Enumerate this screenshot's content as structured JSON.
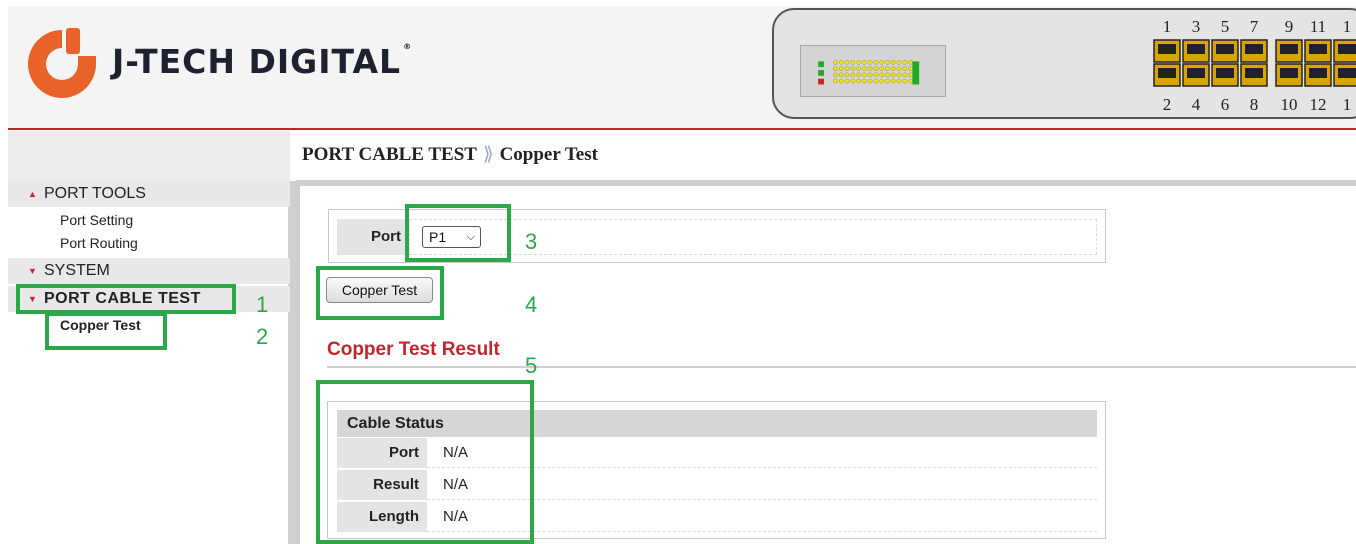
{
  "header": {
    "brand": "J-TECH DIGITAL",
    "brand_mark": "®",
    "port_numbers_top": [
      "1",
      "3",
      "5",
      "7",
      "9",
      "11",
      "1"
    ],
    "port_numbers_bottom": [
      "2",
      "4",
      "6",
      "8",
      "10",
      "12",
      "1"
    ],
    "logo_color": "#e8622a"
  },
  "breadcrumb": {
    "section": "PORT CABLE TEST",
    "separator": "⟫",
    "page": "Copper Test"
  },
  "sidebar": {
    "sections": [
      {
        "label": "PORT TOOLS",
        "arrow": "▲",
        "items": [
          "Port Setting",
          "Port Routing"
        ]
      },
      {
        "label": "SYSTEM",
        "arrow": "▼",
        "items": []
      },
      {
        "label": "PORT CABLE TEST",
        "arrow": "▼",
        "items": [
          "Copper Test"
        ]
      }
    ]
  },
  "form": {
    "port_label": "Port",
    "port_selected": "P1",
    "copper_test_button": "Copper Test"
  },
  "result": {
    "title": "Copper Test Result",
    "table_header": "Cable Status",
    "rows": [
      {
        "label": "Port",
        "value": "N/A"
      },
      {
        "label": "Result",
        "value": "N/A"
      },
      {
        "label": "Length",
        "value": "N/A"
      }
    ]
  },
  "annotations": [
    "1",
    "2",
    "3",
    "4",
    "5"
  ],
  "colors": {
    "accent": "#c0272d",
    "annotation": "#2aa84a",
    "header_bg": "#f4f4f4"
  }
}
